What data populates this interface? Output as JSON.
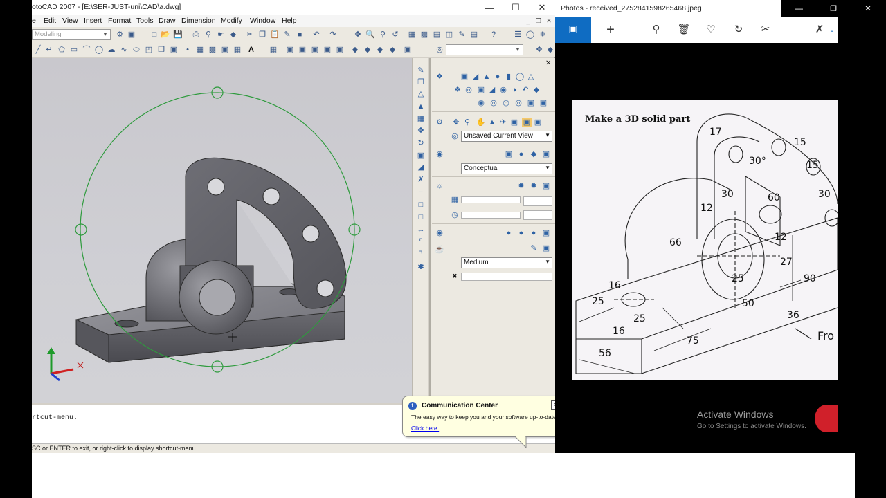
{
  "acad": {
    "title": "otoCAD 2007 - [E:\\SER-JUST-uni\\CAD\\a.dwg]",
    "menu": [
      "e",
      "Edit",
      "View",
      "Insert",
      "Format",
      "Tools",
      "Draw",
      "Dimension",
      "Modify",
      "Window",
      "Help"
    ],
    "workspace_combo": "Modeling",
    "dashboard": {
      "view_combo": "Unsaved Current View",
      "visual_style_combo": "Conceptual",
      "quality_combo": "Medium"
    },
    "command_lines": [
      "rtcut-menu."
    ],
    "status_text": "SC or ENTER to exit, or right-click to display shortcut-menu."
  },
  "comm_center": {
    "title": "Communication Center",
    "body": "The easy way to keep you and your software up-to-date.",
    "link": "Click here."
  },
  "photos": {
    "title": "Photos - received_2752841598265468.jpeg",
    "image_heading": "Make a 3D solid part",
    "dims": [
      "17",
      "30°",
      "15",
      "15",
      "30",
      "12",
      "30",
      "60",
      "12",
      "66",
      "16",
      "25",
      "25",
      "25",
      "50",
      "27",
      "90",
      "36",
      "16",
      "75",
      "56"
    ],
    "from_label": "Fro",
    "watermark_title": "Activate Windows",
    "watermark_sub": "Go to Settings to activate Windows."
  },
  "colors": {
    "selection_blue": "#0f6cc2",
    "orbit_green": "#2e9b3d",
    "balloon_yellow": "#ffffe1"
  }
}
